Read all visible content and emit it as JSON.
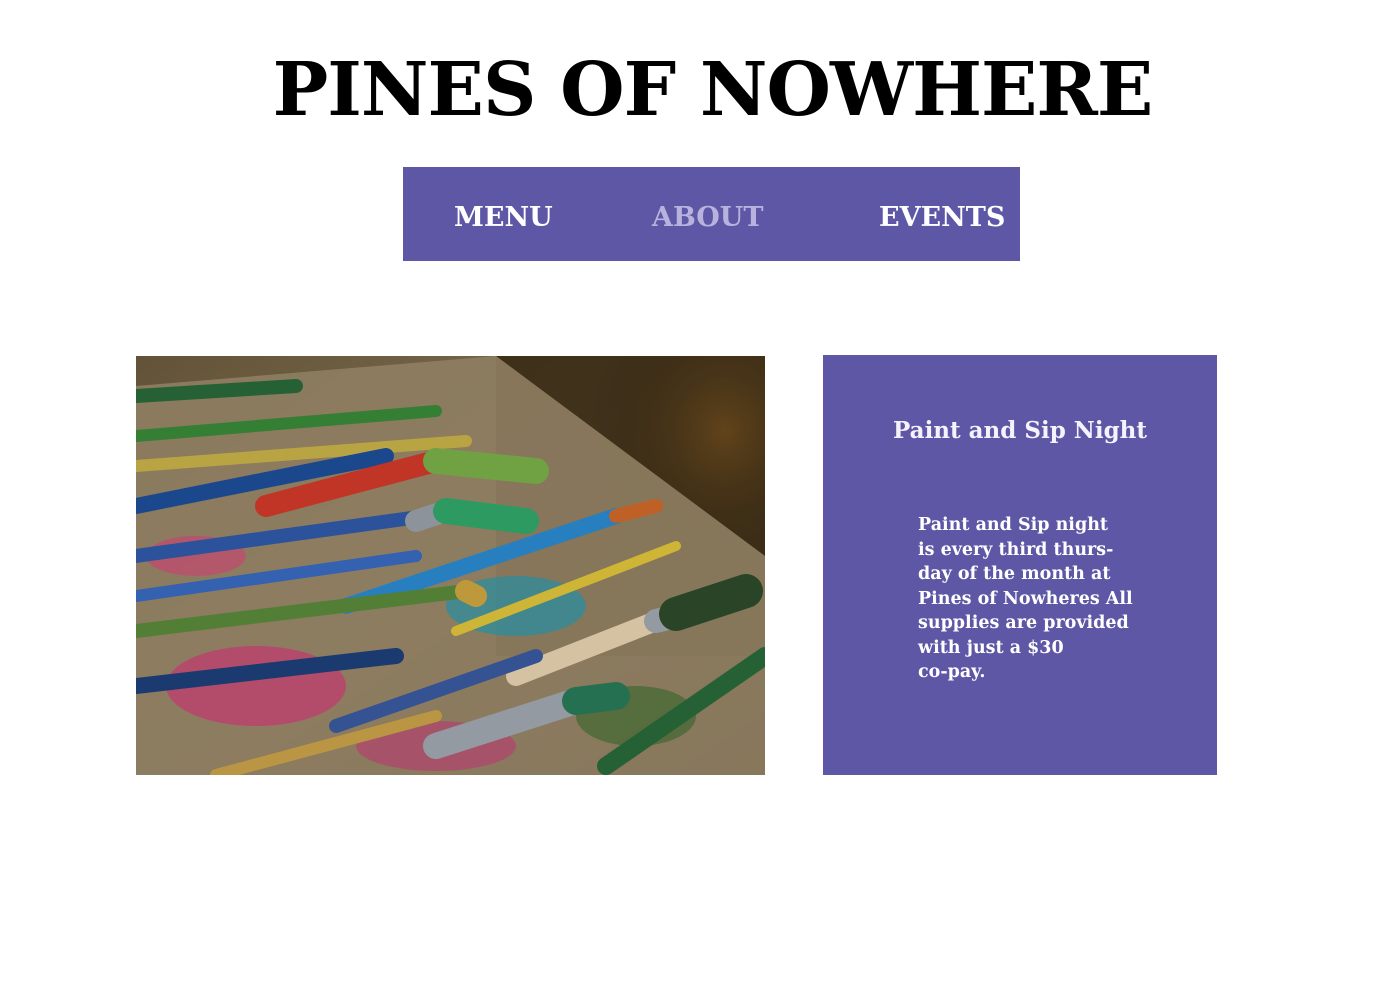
{
  "site": {
    "title": "PINES OF NOWHERE"
  },
  "nav": {
    "items": [
      {
        "label": "MENU"
      },
      {
        "label": "ABOUT"
      },
      {
        "label": "EVENTS"
      }
    ],
    "colors": {
      "background": "#5e57a6",
      "text": "#ffffff",
      "active_text": "#b8b3de"
    }
  },
  "hero_image": {
    "subject": "paint-brushes-photo"
  },
  "event": {
    "title": "Paint and Sip Night",
    "description": "Paint and Sip night\nis every third thurs-\nday of the month at\nPines of Nowheres All\nsupplies are provided\nwith just a $30\nco-pay.",
    "background": "#5e57a6"
  }
}
